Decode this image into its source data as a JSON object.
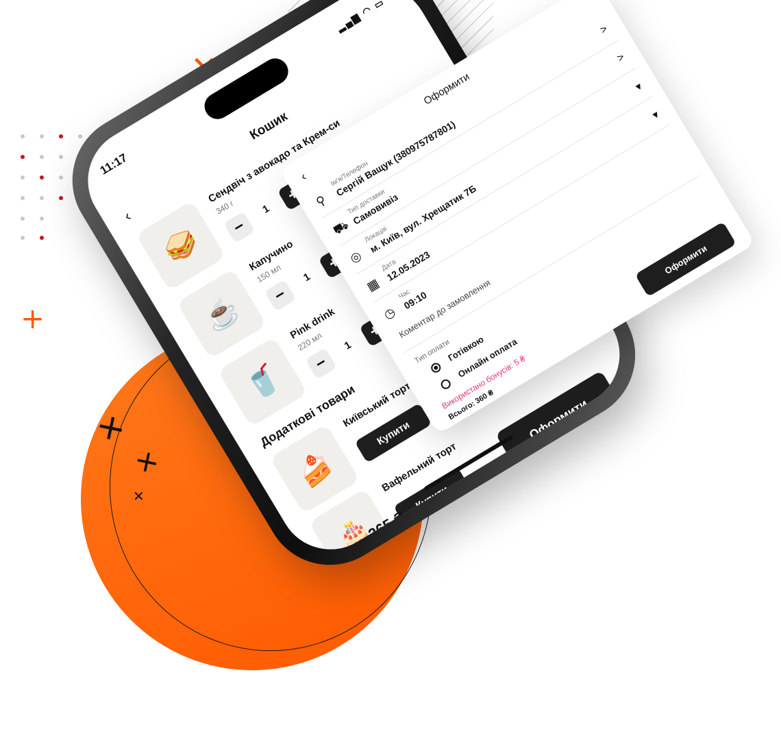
{
  "colors": {
    "accent": "#ff5a00",
    "dark": "#1e1e1e",
    "bonus": "#e2347c"
  },
  "status_bar": {
    "time": "11:17",
    "icons": "signal wifi battery"
  },
  "cart": {
    "title": "Кошик",
    "items": [
      {
        "name": "Сендвіч з авокадо та Крем-си",
        "weight": "340 г",
        "qty": "1",
        "icon": "sandwich-icon"
      },
      {
        "name": "Капучино",
        "weight": "150 мл",
        "qty": "1",
        "icon": "coffee-icon"
      },
      {
        "name": "Pink drink",
        "weight": "220 мл",
        "qty": "1",
        "icon": "drink-icon"
      }
    ],
    "extras_title": "Додаткові товари",
    "extras": [
      {
        "name": "Київський торт",
        "button": "Купити",
        "icon": "cake-icon"
      },
      {
        "name": "Вафельний торт",
        "button": "Купити",
        "icon": "cake-icon"
      }
    ],
    "total_label": "Всього:",
    "total_value": "365 ₴",
    "checkout_label": "Оформити"
  },
  "checkout": {
    "title": "Оформити",
    "fields": [
      {
        "label": "Ім'я/Телефон",
        "value": "Сергій Ващук (380975787801)",
        "icon": "user-icon",
        "chevron": ">"
      },
      {
        "label": "Тип доставки",
        "value": "Самовивіз",
        "icon": "car-icon",
        "chevron": ">"
      },
      {
        "label": "Локація",
        "value": "м. Київ, вул. Хрещатик 7Б",
        "icon": "location-icon",
        "chevron": "▾"
      },
      {
        "label": "Дата",
        "value": "12.05.2023",
        "icon": "calendar-icon",
        "chevron": "▾"
      },
      {
        "label": "Час",
        "value": "09:10",
        "icon": "clock-icon",
        "chevron": ""
      }
    ],
    "comment_label": "Коментар до замовлення",
    "payment_type_label": "Тип оплати",
    "payment_options": [
      {
        "label": "Готівкою",
        "selected": true
      },
      {
        "label": "Онлайн оплата",
        "selected": false
      }
    ],
    "bonus_label": "Використано бонусів:",
    "bonus_value": "5 ₴",
    "total": "Всього: 360 ₴",
    "submit_label": "Оформити"
  }
}
